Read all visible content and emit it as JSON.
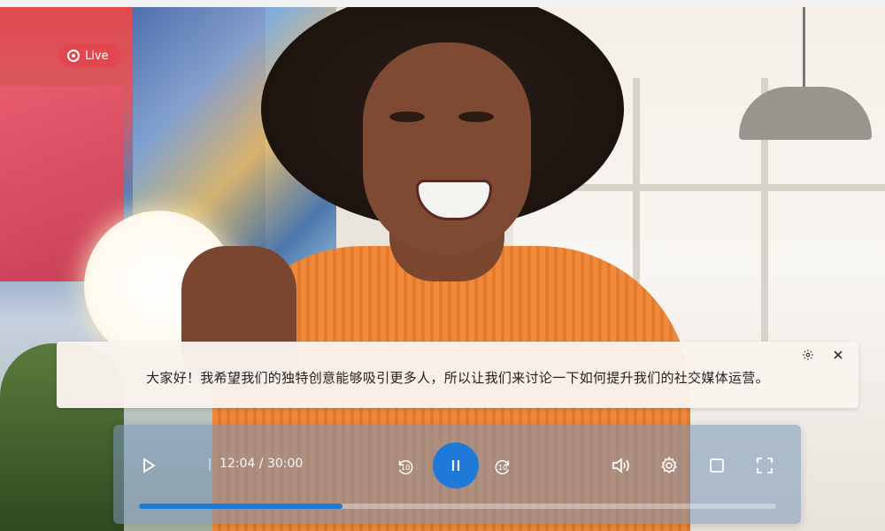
{
  "live": {
    "label": "Live",
    "color": "#e2474f"
  },
  "subtitle": {
    "text": "大家好！我希望我们的独特创意能够吸引更多人，所以让我们来讨论一下如何提升我们的社交媒体运营。",
    "settings_icon": "gear-icon",
    "close_icon": "close-icon"
  },
  "player": {
    "time": "12:04 / 30:00",
    "progress": 0.32,
    "rewind_seconds": "10",
    "forward_seconds": "10",
    "accent_color": "#1e7ad6",
    "icons": {
      "play": "play-icon",
      "rewind": "rewind-10-icon",
      "pause": "pause-icon",
      "forward": "forward-10-icon",
      "volume": "volume-icon",
      "settings": "gear-icon",
      "miniplayer": "square-icon",
      "fullscreen": "fullscreen-icon"
    }
  }
}
